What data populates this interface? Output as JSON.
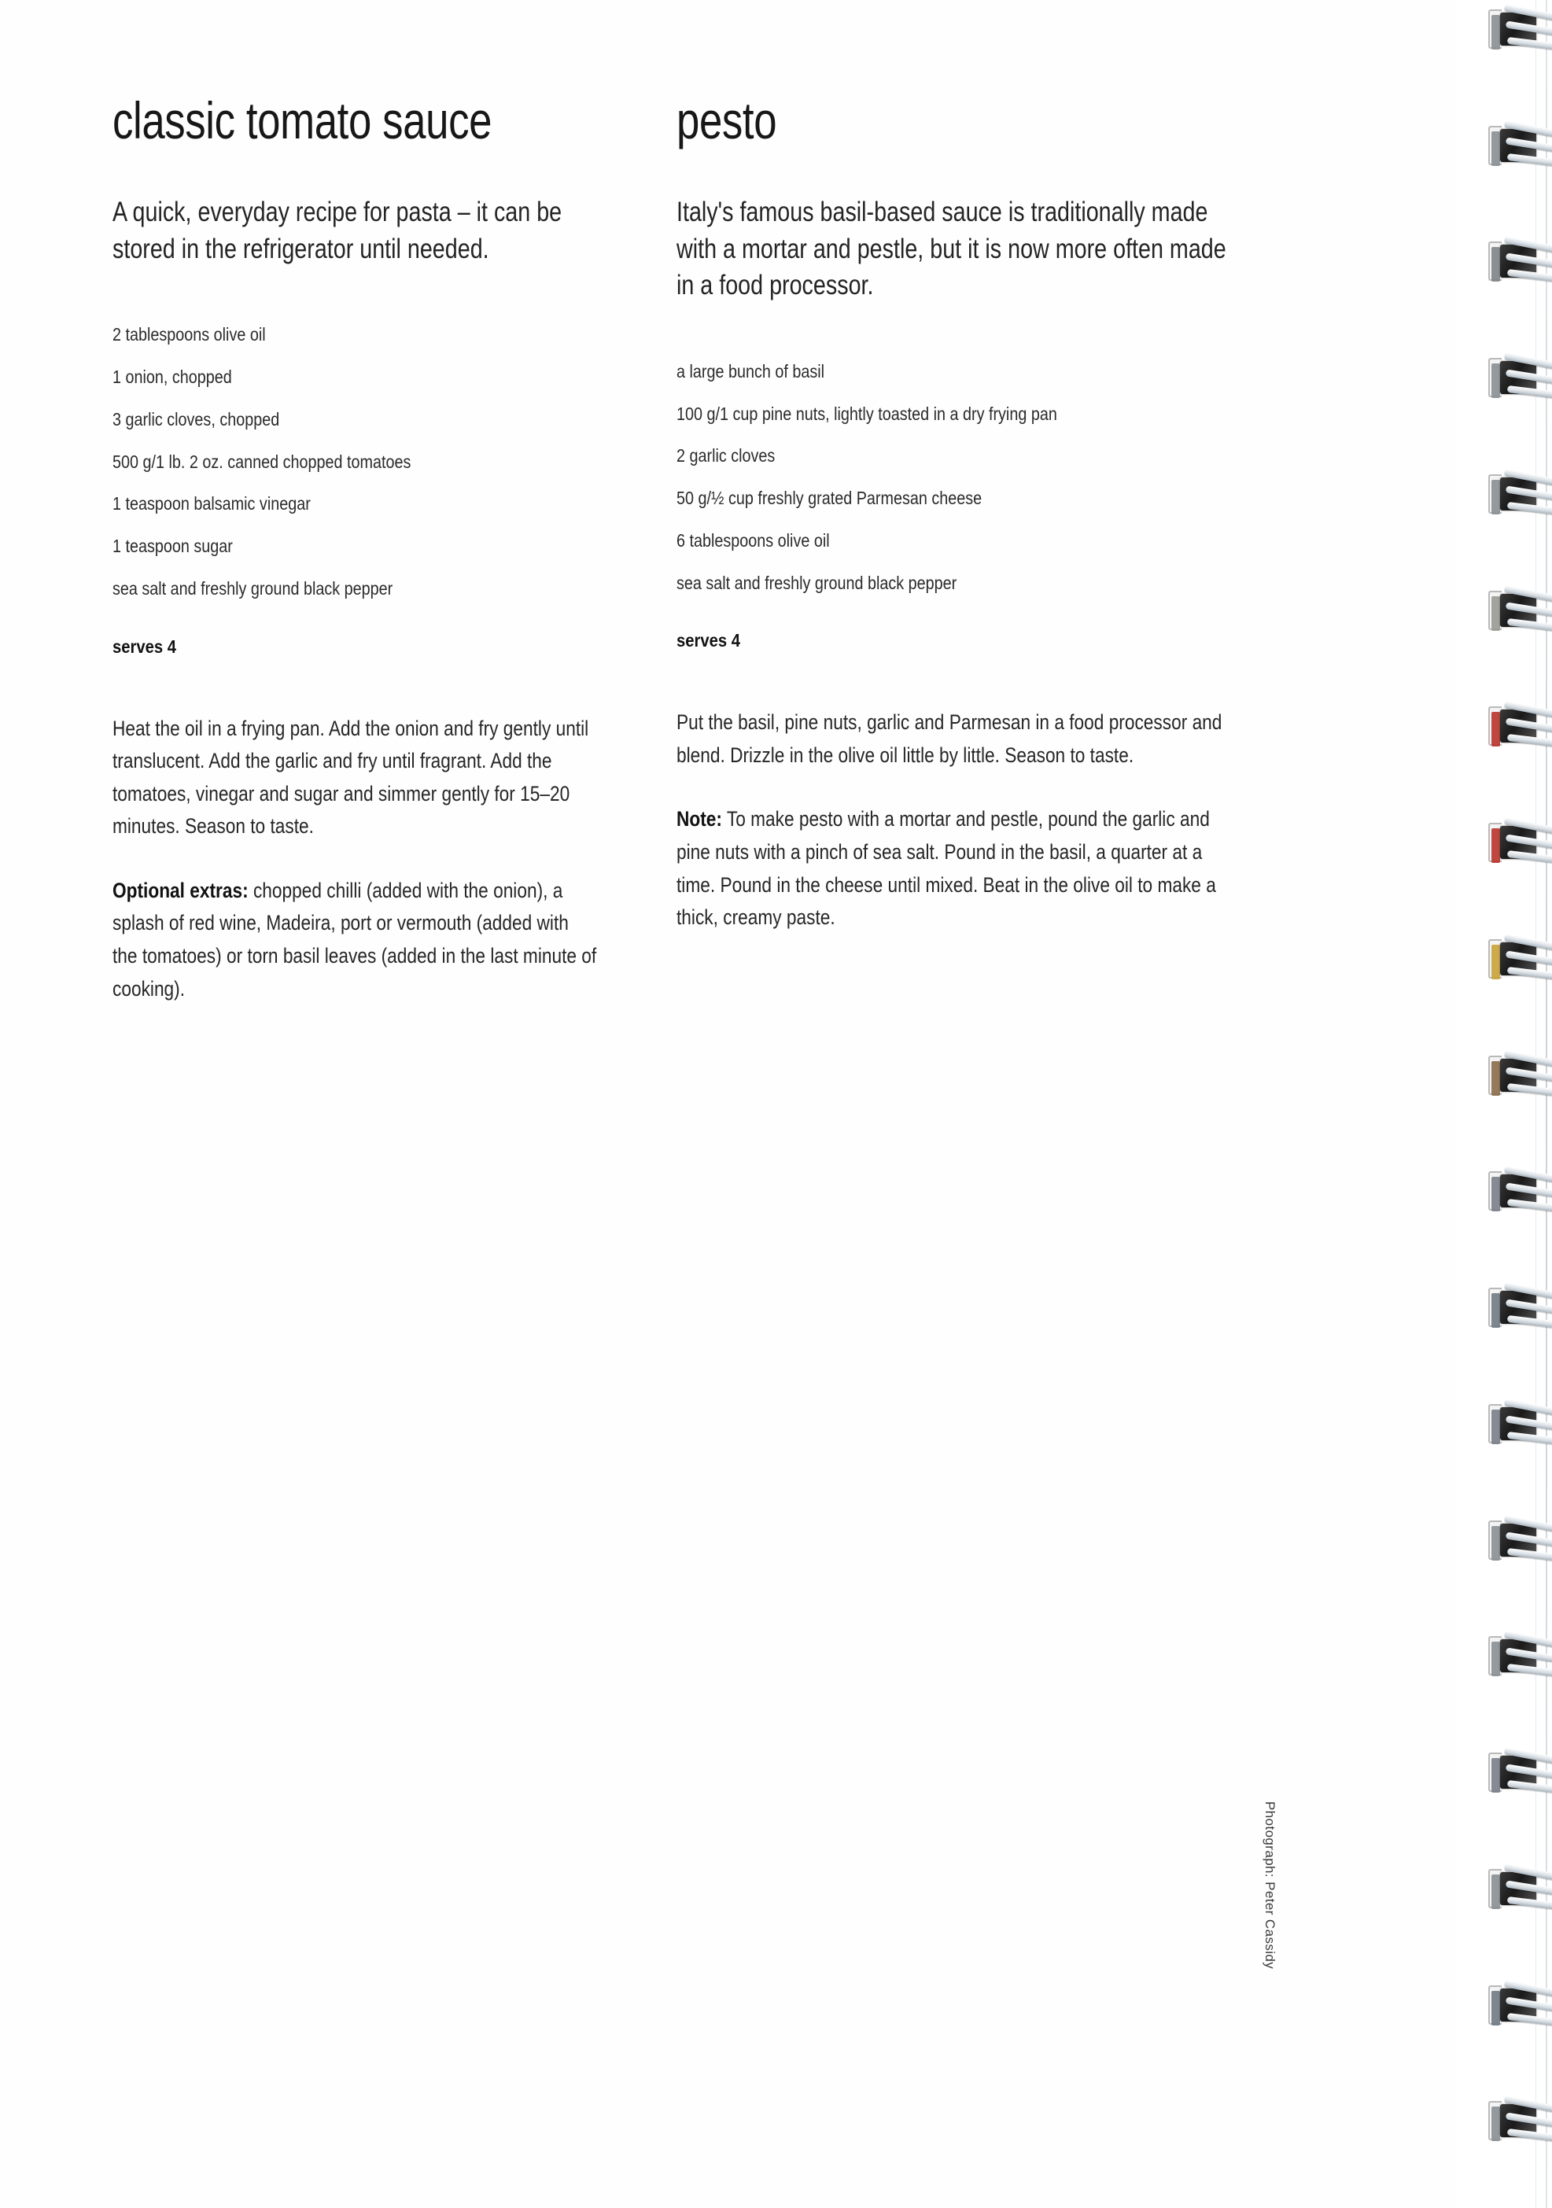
{
  "page": {
    "photo_credit": "Photograph: Peter Cassidy"
  },
  "recipes": [
    {
      "title": "classic tomato sauce",
      "intro": "A quick, everyday recipe for pasta – it can be stored in the refrigerator until needed.",
      "ingredients": [
        "2 tablespoons olive oil",
        "1 onion, chopped",
        "3 garlic cloves, chopped",
        "500 g/1 lb. 2 oz. canned chopped tomatoes",
        "1 teaspoon balsamic vinegar",
        "1 teaspoon sugar",
        "sea salt and freshly ground black pepper"
      ],
      "serves": "serves 4",
      "method": [
        {
          "lead": "",
          "text": "Heat the oil in a frying pan. Add the onion and fry gently until translucent. Add the garlic and fry until fragrant. Add the tomatoes, vinegar and sugar and simmer gently for 15–20 minutes. Season to taste."
        },
        {
          "lead": "Optional extras:",
          "text": " chopped chilli (added with the onion), a splash of red wine, Madeira, port or vermouth (added with the tomatoes) or torn basil leaves (added in the last minute of cooking)."
        }
      ]
    },
    {
      "title": "pesto",
      "intro": "Italy's famous basil-based sauce is traditionally made with a mortar and pestle, but it is now more often made in a food processor.",
      "ingredients": [
        "a large bunch of basil",
        "100 g/1 cup pine nuts, lightly toasted in a dry frying pan",
        "2 garlic cloves",
        "50 g/½ cup freshly grated Parmesan cheese",
        "6 tablespoons olive oil",
        "sea salt and freshly ground black pepper"
      ],
      "serves": "serves 4",
      "method": [
        {
          "lead": "",
          "text": "Put the basil, pine nuts, garlic and Parmesan in a food processor and blend. Drizzle in the olive oil little by little. Season to taste."
        },
        {
          "lead": "Note:",
          "text": " To make pesto with a mortar and pestle, pound the garlic and pine nuts with a pinch of sea salt. Pound in the basil, a quarter at a time. Pound in the cheese until mixed. Beat in the olive oil to make a thick, creamy paste."
        }
      ]
    }
  ],
  "binding": {
    "ring_count": 19,
    "page_edge_colors": [
      "#8a8f93",
      "#8a8f93",
      "#7f8488",
      "#8a8f93",
      "#8a8f93",
      "#9a9a93",
      "#b8342b",
      "#b8342b",
      "#c9a23a",
      "#8a6b4a",
      "#7a8088",
      "#6f7a84",
      "#7a8088",
      "#8a8f93",
      "#8a8f93",
      "#7a8088",
      "#8a8f93",
      "#6f7a84",
      "#8a8f93"
    ]
  }
}
